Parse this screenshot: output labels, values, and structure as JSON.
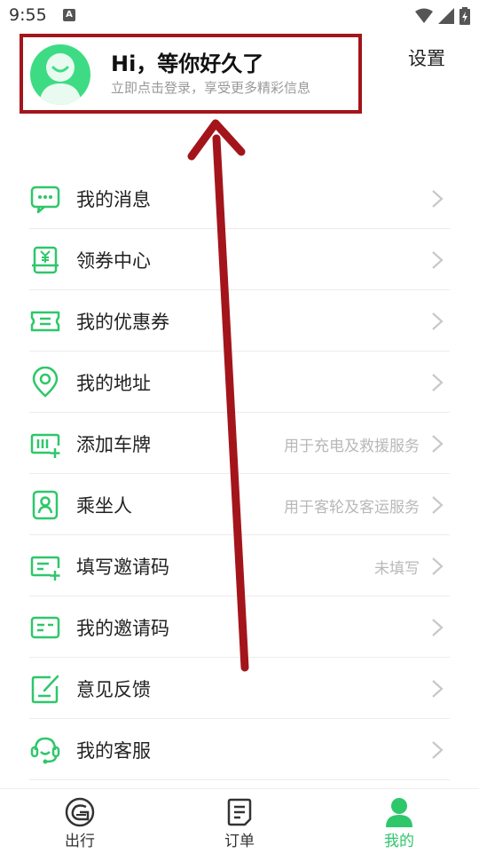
{
  "status": {
    "time": "9:55",
    "a_badge": "A"
  },
  "profile": {
    "greeting": "Hi，等你好久了",
    "hint": "立即点击登录，享受更多精彩信息"
  },
  "header": {
    "settings": "设置"
  },
  "menu": [
    {
      "label": "我的消息",
      "hint": "",
      "icon": "message-icon"
    },
    {
      "label": "领券中心",
      "hint": "",
      "icon": "coupon-center-icon"
    },
    {
      "label": "我的优惠券",
      "hint": "",
      "icon": "ticket-icon"
    },
    {
      "label": "我的地址",
      "hint": "",
      "icon": "location-icon"
    },
    {
      "label": "添加车牌",
      "hint": "用于充电及救援服务",
      "icon": "license-plate-icon"
    },
    {
      "label": "乘坐人",
      "hint": "用于客轮及客运服务",
      "icon": "passenger-icon"
    },
    {
      "label": "填写邀请码",
      "hint": "未填写",
      "icon": "enter-invite-code-icon"
    },
    {
      "label": "我的邀请码",
      "hint": "",
      "icon": "invite-code-icon"
    },
    {
      "label": "意见反馈",
      "hint": "",
      "icon": "feedback-icon"
    },
    {
      "label": "我的客服",
      "hint": "",
      "icon": "customer-service-icon"
    }
  ],
  "tabs": [
    {
      "label": "出行",
      "icon": "travel-icon",
      "active": false
    },
    {
      "label": "订单",
      "icon": "order-icon",
      "active": false
    },
    {
      "label": "我的",
      "icon": "profile-icon",
      "active": true
    }
  ],
  "colors": {
    "accent": "#2ec76a",
    "annotation": "#a3151b",
    "hint_text": "#b8b8b8"
  }
}
